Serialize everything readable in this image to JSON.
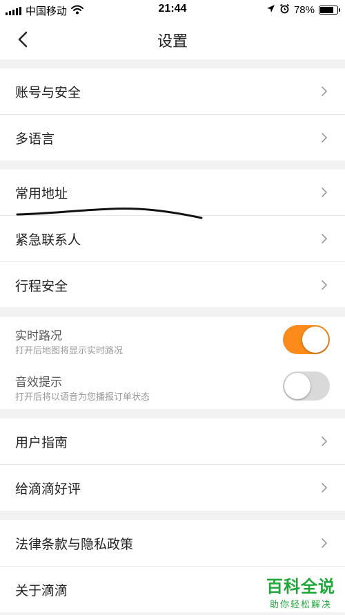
{
  "status_bar": {
    "carrier": "中国移动",
    "time": "21:44",
    "battery_percent": "78%",
    "battery_level": 0.78,
    "icons": [
      "signal-icon",
      "wifi-icon",
      "location-arrow-icon",
      "alarm-icon",
      "battery-icon"
    ]
  },
  "header": {
    "title": "设置",
    "back_icon": "chevron-left-icon"
  },
  "groups": [
    {
      "items": [
        {
          "label": "账号与安全"
        },
        {
          "label": "多语言"
        }
      ]
    },
    {
      "items": [
        {
          "label": "常用地址"
        },
        {
          "label": "紧急联系人"
        },
        {
          "label": "行程安全"
        }
      ]
    },
    {
      "toggles": [
        {
          "label": "实时路况",
          "description": "打开后地图将显示实时路况",
          "on": true
        },
        {
          "label": "音效提示",
          "description": "打开后将以语音为您播报订单状态",
          "on": false
        }
      ]
    },
    {
      "items": [
        {
          "label": "用户指南"
        },
        {
          "label": "给滴滴好评"
        }
      ]
    },
    {
      "items": [
        {
          "label": "法律条款与隐私政策"
        },
        {
          "label": "关于滴滴"
        }
      ]
    }
  ],
  "watermark": {
    "main": "百科全说",
    "sub": "助你轻松解决"
  },
  "colors": {
    "toggle_on": "#fc8b1b",
    "toggle_off": "#d9d9d9",
    "watermark": "#1fa83a",
    "background": "#f2f2f2"
  }
}
